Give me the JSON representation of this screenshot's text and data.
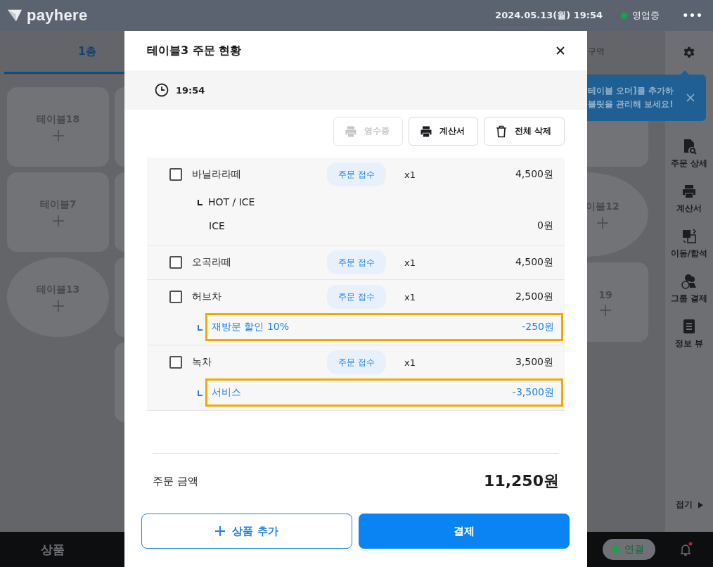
{
  "top_bar": {
    "logo": "payhere",
    "datetime": "2024.05.13(월) 19:54",
    "status": {
      "label": "영업중",
      "color": "#16a34a"
    },
    "more": "•••"
  },
  "floor_tabs": [
    {
      "label": "1층",
      "selected": true
    },
    {
      "label": "구역",
      "selected": false
    }
  ],
  "tables_left": [
    {
      "name": "테이블18",
      "kind": "rounded"
    },
    {
      "name": "테이블7",
      "kind": "rounded"
    },
    {
      "name": "테이블13",
      "kind": "oval"
    }
  ],
  "tables_right": [
    {
      "name": "이블12",
      "kind": "oval"
    },
    {
      "name": "19",
      "kind": "rounded"
    }
  ],
  "tooltip": {
    "lines": [
      "테이블 오더]를 추가하",
      "블릿을 관리해 보세요!"
    ]
  },
  "sidebar": {
    "items": [
      {
        "label": "주문 상세"
      },
      {
        "label": "계산서"
      },
      {
        "label": "이동/합석"
      },
      {
        "label": "그룹 결제"
      },
      {
        "label": "정보 뷰"
      }
    ],
    "collapse": "접기"
  },
  "bottom_bar": {
    "tab": "상품",
    "connection": {
      "label": "연결",
      "color": "#16a34a"
    },
    "notification": true
  },
  "modal": {
    "title": "테이블3 주문 현황",
    "time": "19:54",
    "actions": [
      {
        "label": "영수증",
        "disabled": true
      },
      {
        "label": "계산서",
        "disabled": false
      },
      {
        "label": "전체 삭제",
        "disabled": false
      }
    ],
    "items": [
      {
        "name": "바닐라라떼",
        "checked": false,
        "status": "주문 접수",
        "qty": "x1",
        "price": "4,500원",
        "lines": [
          {
            "kind": "option_group",
            "label": "HOT / ICE"
          },
          {
            "kind": "option",
            "label": "ICE",
            "price": "0원"
          }
        ]
      },
      {
        "name": "오곡라떼",
        "checked": false,
        "status": "주문 접수",
        "qty": "x1",
        "price": "4,500원"
      },
      {
        "name": "허브차",
        "checked": false,
        "status": "주문 접수",
        "qty": "x1",
        "price": "2,500원",
        "lines": [
          {
            "kind": "discount",
            "label": "재방문 할인 10%",
            "price": "-250원",
            "highlighted": true
          }
        ]
      },
      {
        "name": "녹차",
        "checked": false,
        "status": "주문 접수",
        "qty": "x1",
        "price": "3,500원",
        "lines": [
          {
            "kind": "discount",
            "label": "서비스",
            "price": "-3,500원",
            "highlighted": true
          }
        ]
      }
    ],
    "total": {
      "label": "주문 금액",
      "amount": "11,250원"
    },
    "buttons": [
      {
        "label": "상품 추가",
        "kind": "secondary"
      },
      {
        "label": "결제",
        "kind": "primary"
      }
    ]
  }
}
